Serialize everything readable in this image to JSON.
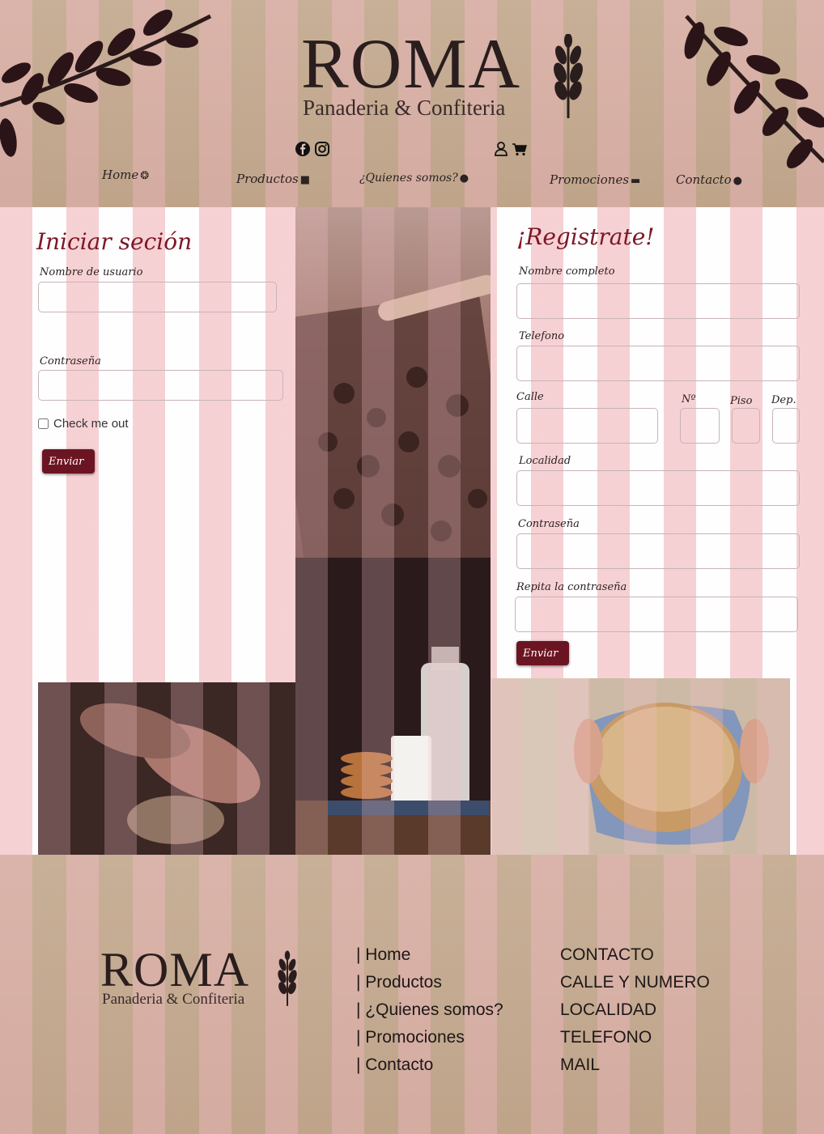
{
  "brand": {
    "name": "ROMA",
    "tagline": "Panaderia & Confiteria",
    "colors": {
      "accent": "#7d1726",
      "button": "#6c1522",
      "stripe_pink": "#f6d0d4",
      "text_dark": "#2a1d1d"
    }
  },
  "header": {
    "social_icons": [
      "facebook-icon",
      "instagram-icon"
    ],
    "user_icons": [
      "user-icon",
      "cart-icon"
    ],
    "nav": [
      {
        "label": "Home",
        "icon": "cookie-icon"
      },
      {
        "label": "Productos",
        "icon": "cake-icon"
      },
      {
        "label": "¿Quienes somos?",
        "icon": "chef-hat-icon"
      },
      {
        "label": "Promociones",
        "icon": "burger-icon"
      },
      {
        "label": "Contacto",
        "icon": "cookie-dots-icon"
      }
    ]
  },
  "login": {
    "title": "Iniciar seción",
    "username_label": "Nombre de usuario",
    "username_value": "",
    "password_label": "Contraseña",
    "password_value": "",
    "checkbox_label": "Check me out",
    "checkbox_checked": false,
    "submit_label": "Enviar"
  },
  "register": {
    "title": "¡Registrate!",
    "fullname_label": "Nombre completo",
    "phone_label": "Telefono",
    "street_label": "Calle",
    "number_label": "Nº",
    "floor_label": "Piso",
    "dept_label": "Dep.",
    "city_label": "Localidad",
    "password_label": "Contraseña",
    "password_repeat_label": "Repita la contraseña",
    "submit_label": "Enviar"
  },
  "footer": {
    "links": [
      "| Home",
      "| Productos",
      "| ¿Quienes somos?",
      "| Promociones",
      "| Contacto"
    ],
    "contact": [
      "CONTACTO",
      "CALLE Y NUMERO",
      "LOCALIDAD",
      "TELEFONO",
      "MAIL"
    ]
  }
}
